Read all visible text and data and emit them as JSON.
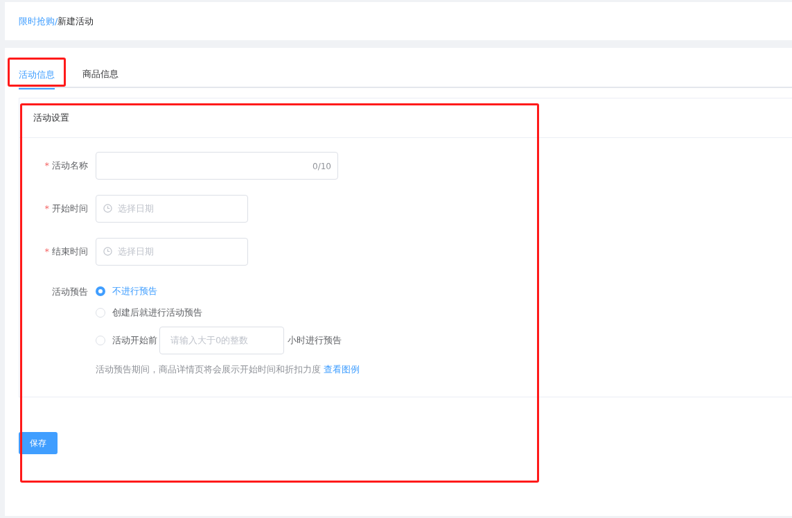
{
  "breadcrumb": [
    {
      "label": "限时抢购/",
      "kind": "link"
    },
    {
      "label": "新建活动",
      "kind": "current"
    }
  ],
  "tabs": [
    {
      "label": "活动信息",
      "selected": true,
      "highlighted": true
    },
    {
      "label": "商品信息",
      "selected": false,
      "highlighted": false
    }
  ],
  "settings_card": {
    "title": "活动设置",
    "highlighted": true,
    "fields": [
      {
        "label": "活动名称",
        "required_mark": "*",
        "kind": "text",
        "counter": "0/10"
      },
      {
        "label": "开始时间",
        "required_mark": "*",
        "kind": "date",
        "placeholder": "选择日期"
      },
      {
        "label": "结束时间",
        "required_mark": "*",
        "kind": "date",
        "placeholder": "选择日期"
      }
    ],
    "preview": {
      "label": "活动预告",
      "options": [
        {
          "label": "不进行预告",
          "selected": true,
          "kind": "plain"
        },
        {
          "label": "创建后就进行活动预告",
          "selected": false,
          "kind": "plain"
        },
        {
          "label": "活动开始前",
          "selected": false,
          "kind": "with_input",
          "placeholder": "请输入大于0的整数",
          "suffix": "小时进行预告"
        }
      ],
      "hint": "活动预告期间，商品详情页将会展示开始时间和折扣力度",
      "hint_link": "查看图例"
    }
  },
  "save_button": "保存"
}
